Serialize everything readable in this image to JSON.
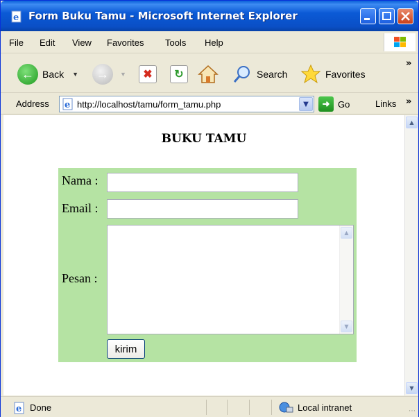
{
  "window": {
    "title": "Form Buku Tamu - Microsoft Internet Explorer",
    "title_bar_color": "#0a4fc6"
  },
  "menu": {
    "items": [
      "File",
      "Edit",
      "View",
      "Favorites",
      "Tools",
      "Help"
    ]
  },
  "toolbar": {
    "back_label": "Back",
    "search_label": "Search",
    "favorites_label": "Favorites",
    "overflow": "»"
  },
  "address_bar": {
    "label": "Address",
    "url": "http://localhost/tamu/form_tamu.php",
    "go_label": "Go",
    "links_label": "Links",
    "links_overflow": "»"
  },
  "page": {
    "heading": "BUKU TAMU",
    "panel_color": "#b5e3a3",
    "form": {
      "nama_label": "Nama :",
      "nama_value": "",
      "email_label": "Email :",
      "email_value": "",
      "pesan_label": "Pesan :",
      "pesan_value": "",
      "submit_label": "kirim"
    }
  },
  "status_bar": {
    "status_text": "Done",
    "zone_text": "Local intranet"
  }
}
